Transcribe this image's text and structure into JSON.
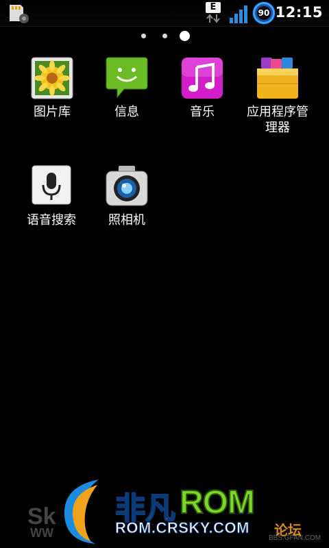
{
  "status_bar": {
    "network_type": "E",
    "battery_level": "90",
    "time": "12:15",
    "icons": [
      "sd-card-icon",
      "data-arrows-icon",
      "signal-icon",
      "battery-icon"
    ]
  },
  "page_indicator": {
    "total": 3,
    "active": 3
  },
  "apps": [
    {
      "label": "图片库",
      "icon": "gallery-icon"
    },
    {
      "label": "信息",
      "icon": "messaging-icon"
    },
    {
      "label": "音乐",
      "icon": "music-icon"
    },
    {
      "label": "应用程序管\n理器",
      "icon": "app-manager-icon"
    },
    {
      "label": "语音搜索",
      "icon": "voice-search-icon"
    },
    {
      "label": "照相机",
      "icon": "camera-icon"
    }
  ],
  "watermark": {
    "brand_cn": "非凡",
    "brand_rom": "ROM",
    "url": "ROM.CRSKY.COM",
    "left_text": "Sk",
    "left_www": "WW",
    "forum_text": "论坛",
    "bbs_text": "BBS.GFAN.COM"
  },
  "colors": {
    "background": "#000000",
    "rom_green": "#7fd62b",
    "battery_blue": "#3aa5ff"
  }
}
